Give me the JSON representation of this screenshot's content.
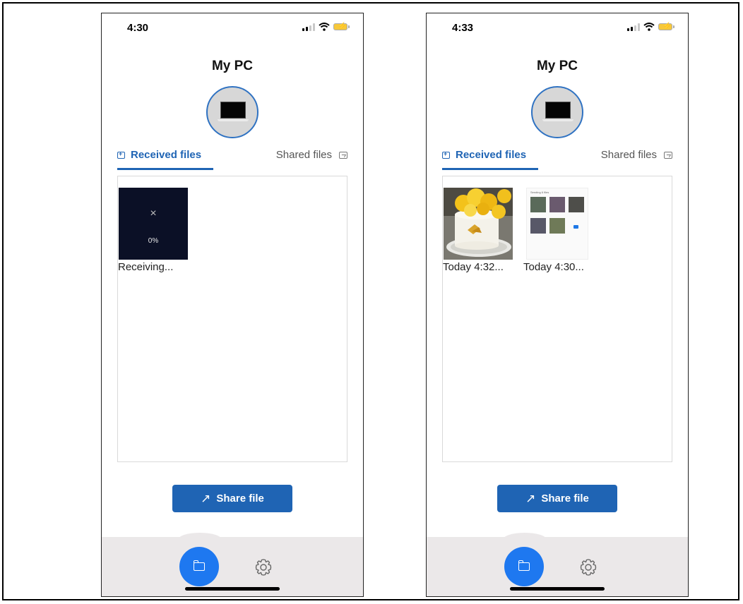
{
  "screens": [
    {
      "status": {
        "time": "4:30"
      },
      "device_title": "My PC",
      "tabs": {
        "received": "Received files",
        "shared": "Shared files"
      },
      "transfer": {
        "cancel_glyph": "×",
        "progress_text": "0%",
        "progress": 0.0,
        "label": "Receiving..."
      },
      "share_button": "Share file"
    },
    {
      "status": {
        "time": "4:33"
      },
      "device_title": "My PC",
      "tabs": {
        "received": "Received files",
        "shared": "Shared files"
      },
      "files": [
        {
          "label": "Today 4:32...",
          "kind": "photo"
        },
        {
          "label": "Today 4:30...",
          "kind": "screenshot",
          "preview_header": "Sending 6 files"
        }
      ],
      "share_button": "Share file"
    }
  ],
  "colors": {
    "accent": "#1f64b4",
    "fab": "#1e78f0",
    "bottom_bar": "#ebe8e9",
    "transfer_card": "#0b1026"
  },
  "icons": {
    "tab_received": "download-tray-icon",
    "tab_shared": "shared-folder-icon",
    "share": "share-arrow-icon",
    "nav_files": "folder-icon",
    "nav_settings": "gear-icon"
  }
}
